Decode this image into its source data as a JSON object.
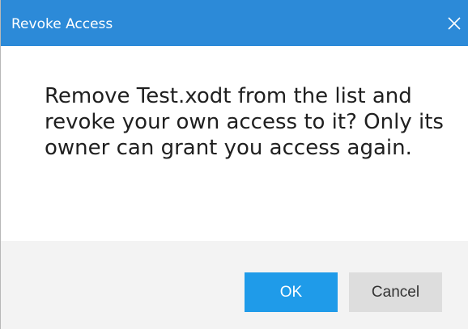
{
  "dialog": {
    "title": "Revoke Access",
    "close_icon": "close-icon",
    "message": "Remove Test.xodt from the list and revoke your own access to it? Only its owner can grant you access again.",
    "ok_label": "OK",
    "cancel_label": "Cancel"
  },
  "colors": {
    "titlebar": "#2c8ad8",
    "ok_button": "#1f9be9",
    "cancel_button": "#dddddd",
    "footer": "#f3f3f3"
  }
}
